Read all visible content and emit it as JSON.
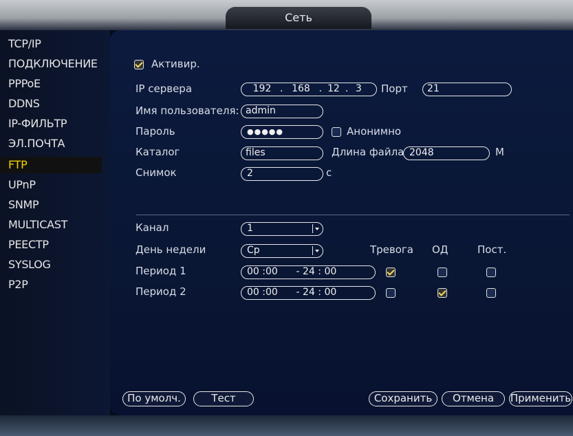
{
  "window": {
    "title": "Сеть"
  },
  "sidebar": {
    "items": [
      {
        "label": "TCP/IP"
      },
      {
        "label": "ПОДКЛЮЧЕНИЕ"
      },
      {
        "label": "PPPoE"
      },
      {
        "label": "DDNS"
      },
      {
        "label": "IP-ФИЛЬТР"
      },
      {
        "label": "ЭЛ.ПОЧТА"
      },
      {
        "label": "FTP",
        "active": true
      },
      {
        "label": "UPnP"
      },
      {
        "label": "SNMP"
      },
      {
        "label": "MULTICAST"
      },
      {
        "label": "РЕЕСТР"
      },
      {
        "label": "SYSLOG"
      },
      {
        "label": "P2P"
      }
    ],
    "active_color": "#f3d400"
  },
  "ftp": {
    "enable_label": "Активир.",
    "enable_checked": true,
    "server_ip_label": "IP сервера",
    "server_ip": [
      "192",
      "168",
      "12",
      "3"
    ],
    "ip_dot": ".",
    "port_label": "Порт",
    "port_value": "21",
    "username_label": "Имя пользователя:",
    "username_value": "admin",
    "password_label": "Пароль",
    "password_value": "●●●●●",
    "anonymous_label": "Анонимно",
    "anonymous_checked": false,
    "directory_label": "Каталог",
    "directory_value": "files",
    "file_length_label": "Длина файла",
    "file_length_value": "2048",
    "file_length_unit": "M",
    "snapshot_label": "Снимок",
    "snapshot_value": "2",
    "snapshot_unit": "с"
  },
  "schedule": {
    "channel_label": "Канал",
    "channel_value": "1",
    "weekday_label": "День недели",
    "weekday_value": "Ср",
    "col_alarm": "Тревога",
    "col_md": "ОД",
    "col_regular": "Пост.",
    "periods": [
      {
        "label": "Период 1",
        "start_h": "00",
        "start_m": "00",
        "end_h": "24",
        "end_m": "00",
        "alarm": true,
        "md": false,
        "regular": false
      },
      {
        "label": "Период 2",
        "start_h": "00",
        "start_m": "00",
        "end_h": "24",
        "end_m": "00",
        "alarm": false,
        "md": true,
        "regular": false
      }
    ]
  },
  "buttons": {
    "default": "По умолч.",
    "test": "Тест",
    "save": "Сохранить",
    "cancel": "Отмена",
    "apply": "Применить"
  }
}
